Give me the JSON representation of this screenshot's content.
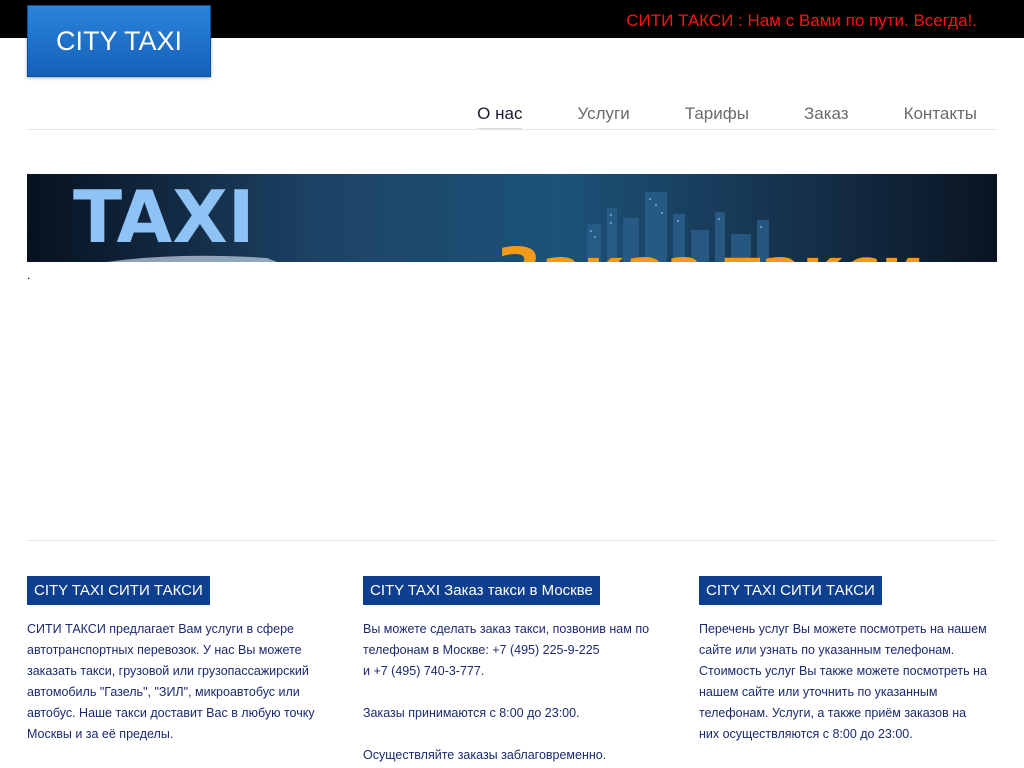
{
  "header": {
    "logo": "CITY TAXI",
    "slogan": "СИТИ ТАКСИ : Нам с Вами по пути. Всегда!."
  },
  "nav": {
    "items": [
      "О нас",
      "Услуги",
      "Тарифы",
      "Заказ",
      "Контакты"
    ],
    "active": "О нас"
  },
  "banner": {
    "text_left": "TAXI",
    "text_right": "Заказ такси"
  },
  "dots": [
    ".",
    "."
  ],
  "columns": [
    {
      "title": "CITY TAXI СИТИ ТАКСИ",
      "lines": [
        "СИТИ ТАКСИ предлагает Вам услуги в сфере",
        "автотранспортных перевозок. У нас Вы можете",
        "заказать такси, грузовой или грузопассажирский",
        "автомобиль \"Газель\", \"ЗИЛ\", микроавтобус или",
        "автобус. Наше такси доставит Вас в любую точку",
        "Москвы и за её пределы."
      ]
    },
    {
      "title": "CITY TAXI Заказ такси в Москве",
      "lines": [
        "Вы можете сделать заказ такси, позвонив нам по",
        "телефонам в Москве: +7 (495) 225-9-225",
        "и +7 (495) 740-3-777.",
        "",
        "Заказы принимаются с 8:00 до 23:00.",
        "",
        "Осуществляйте заказы заблаговременно."
      ]
    },
    {
      "title": "CITY TAXI СИТИ ТАКСИ",
      "lines": [
        "Перечень услуг Вы можете посмотреть на нашем",
        "сайте или узнать по указанным телефонам.",
        "Стоимость услуг Вы также можете посмотреть на",
        "нашем сайте или уточнить по указанным",
        "телефонам. Услуги, а также приём заказов на",
        "них осуществляются с 8:00 до 23:00."
      ]
    }
  ],
  "colors": {
    "topbar": "#000000",
    "slogan": "#f41616",
    "logo_bg": "#1f6fc9",
    "heading_bg": "#0e3f8f",
    "body_text": "#1b2a70"
  }
}
